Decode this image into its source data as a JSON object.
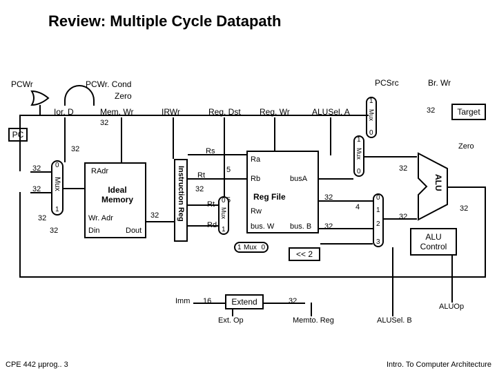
{
  "title": "Review: Multiple Cycle Datapath",
  "signals": {
    "pcwr": "PCWr",
    "pcwrcond": "PCWr. Cond",
    "zero": "Zero",
    "iord": "Ior. D",
    "memwr": "Mem. Wr",
    "irwr": "IRWr",
    "regdst": "Reg. Dst",
    "regwr": "Reg. Wr",
    "pcsrc": "PCSrc",
    "brwr": "Br. Wr",
    "alusela": "ALUSel. A",
    "aluselb": "ALUSel. B",
    "target": "Target",
    "aluop": "ALUOp",
    "extop": "Ext. Op",
    "memtoreg": "Memto. Reg",
    "zero2": "Zero"
  },
  "blocks": {
    "pc": "PC",
    "radr": "RAdr",
    "idealmem": "Ideal Memory",
    "wradr": "Wr. Adr",
    "din": "Din",
    "dout": "Dout",
    "ireg": "Instruction Reg",
    "regfile": "Reg File",
    "ra": "Ra",
    "rb": "Rb",
    "rw": "Rw",
    "busa": "busA",
    "busb": "bus. B",
    "busw": "bus. W",
    "alu": "ALU",
    "aluctl": "ALU Control",
    "extend": "Extend",
    "shift": "<< 2",
    "mux": "Mux",
    "imm": "Imm",
    "rs": "Rs",
    "rt": "Rt",
    "rd": "Rd"
  },
  "widths": {
    "w32": "32",
    "w16": "16",
    "w5": "5",
    "w4": "4"
  },
  "mux_ends": {
    "a": "0",
    "b": "1",
    "c": "2",
    "d": "3"
  },
  "footer": {
    "left": "CPE 442 µprog.. 3",
    "right": "Intro. To Computer Architecture"
  }
}
